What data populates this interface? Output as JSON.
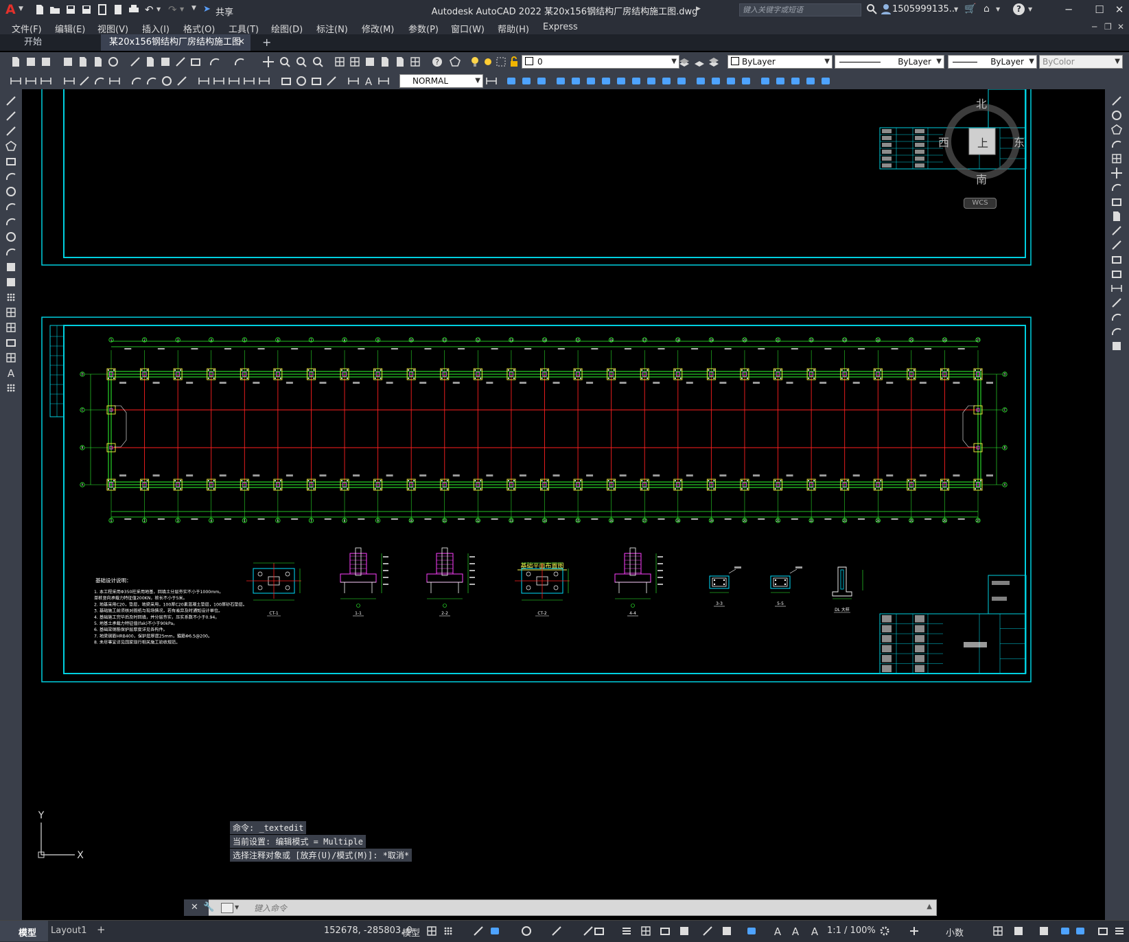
{
  "app": {
    "logo": "A",
    "title": "Autodesk AutoCAD 2022    某20x156钢结构厂房结构施工图.dwg",
    "share_label": "共享",
    "search_placeholder": "键入关键字或短语",
    "user": "1505999135...",
    "colors": {
      "accent": "#00e5ff",
      "titlebar": "#2b2f38",
      "toolbar": "#3a3f4a",
      "green": "#00ff00",
      "red": "#ff0000",
      "magenta": "#ff00ff"
    }
  },
  "menu": [
    "文件(F)",
    "编辑(E)",
    "视图(V)",
    "插入(I)",
    "格式(O)",
    "工具(T)",
    "绘图(D)",
    "标注(N)",
    "修改(M)",
    "参数(P)",
    "窗口(W)",
    "帮助(H)",
    "Express"
  ],
  "tabs": {
    "start": "开始",
    "drawing": "某20x156钢结构厂房结构施工图*",
    "close": "✕",
    "add": "+"
  },
  "props": {
    "layer": "0",
    "color": "ByLayer",
    "linetype": "ByLayer",
    "lineweight": "ByLayer",
    "plotstyle": "ByColor",
    "dimstyle": "NORMAL"
  },
  "viewcube": {
    "north": "北",
    "south": "南",
    "east": "东",
    "west": "西",
    "top": "上",
    "wcs": "WCS"
  },
  "drawing": {
    "plan_title": "基础平面布置图",
    "notes_title": "基础设计说明：",
    "notes": [
      "1. 本工程采用Φ350柱采用地基，回填土分层夯实不小于1000mm。",
      "   单桩竖向承载力特征值200KN，桩长不小于5米。",
      "2. 地基采用C20，垫层，地梁采用，100厚C20素混凝土垫层，100厚砂石垫层。",
      "3. 基础施工前须核对图纸与现场情况，若有差异及时通知设计单位。",
      "4. 基础施工完毕后及时回填，并分层夯实，压实系数不小于0.94。",
      "5. 地基土承载力特征值(fak)不小于90kPa。",
      "6. 基础梁钢筋保护层厚度详见各构件。",
      "7. 地梁钢筋HRB400，保护层厚度25mm，箍筋Φ6.5@200。",
      "8. 未尽事宜详见国家现行相关施工验收规范。"
    ],
    "details": [
      "CT-1",
      "1-1",
      "2-2",
      "CT-2",
      "4-4",
      "3-3",
      "5-5",
      "DL 大样"
    ],
    "axes_top": [
      "1",
      "2",
      "3",
      "4",
      "5",
      "6",
      "7",
      "8",
      "9",
      "10",
      "11",
      "12",
      "13",
      "14",
      "15",
      "16",
      "17",
      "18",
      "19",
      "20",
      "21",
      "22",
      "23",
      "24",
      "25",
      "26",
      "27"
    ],
    "axes_side": [
      "D",
      "C",
      "B",
      "A"
    ],
    "titleblock_rows": [
      "审 定",
      "校 对",
      "专业负责人",
      "项目负责人",
      "注册师"
    ]
  },
  "ucs": {
    "y": "Y",
    "x": "X"
  },
  "command": {
    "lines": [
      "命令: _textedit",
      "当前设置: 编辑模式 = Multiple",
      "选择注释对象或 [放弃(U)/模式(M)]: *取消*"
    ],
    "input_placeholder": "键入命令"
  },
  "layout_tabs": [
    "模型",
    "Layout1",
    "+"
  ],
  "status": {
    "coords": "152678, -285803, 0",
    "space": "模型",
    "scale": "1:1 / 100%",
    "units": "小数"
  }
}
